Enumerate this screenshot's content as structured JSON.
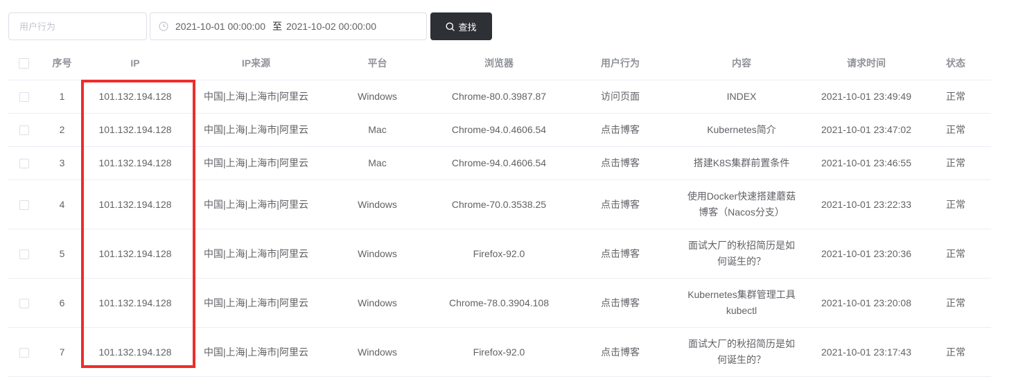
{
  "filters": {
    "behavior_placeholder": "用户行为",
    "date_start": "2021-10-01 00:00:00",
    "date_separator": "至",
    "date_end": "2021-10-02 00:00:00",
    "search_label": "查找"
  },
  "columns": {
    "index": "序号",
    "ip": "IP",
    "ip_source": "IP来源",
    "platform": "平台",
    "browser": "浏览器",
    "behavior": "用户行为",
    "content": "内容",
    "request_time": "请求时间",
    "status": "状态"
  },
  "rows": [
    {
      "index": "1",
      "ip": "101.132.194.128",
      "ip_source": "中国|上海|上海市|阿里云",
      "platform": "Windows",
      "browser": "Chrome-80.0.3987.87",
      "behavior": "访问页面",
      "content": "INDEX",
      "request_time": "2021-10-01 23:49:49",
      "status": "正常"
    },
    {
      "index": "2",
      "ip": "101.132.194.128",
      "ip_source": "中国|上海|上海市|阿里云",
      "platform": "Mac",
      "browser": "Chrome-94.0.4606.54",
      "behavior": "点击博客",
      "content": "Kubernetes简介",
      "request_time": "2021-10-01 23:47:02",
      "status": "正常"
    },
    {
      "index": "3",
      "ip": "101.132.194.128",
      "ip_source": "中国|上海|上海市|阿里云",
      "platform": "Mac",
      "browser": "Chrome-94.0.4606.54",
      "behavior": "点击博客",
      "content": "搭建K8S集群前置条件",
      "request_time": "2021-10-01 23:46:55",
      "status": "正常"
    },
    {
      "index": "4",
      "ip": "101.132.194.128",
      "ip_source": "中国|上海|上海市|阿里云",
      "platform": "Windows",
      "browser": "Chrome-70.0.3538.25",
      "behavior": "点击博客",
      "content": "使用Docker快速搭建蘑菇博客（Nacos分支）",
      "request_time": "2021-10-01 23:22:33",
      "status": "正常"
    },
    {
      "index": "5",
      "ip": "101.132.194.128",
      "ip_source": "中国|上海|上海市|阿里云",
      "platform": "Windows",
      "browser": "Firefox-92.0",
      "behavior": "点击博客",
      "content": "面试大厂的秋招简历是如何诞生的？",
      "request_time": "2021-10-01 23:20:36",
      "status": "正常"
    },
    {
      "index": "6",
      "ip": "101.132.194.128",
      "ip_source": "中国|上海|上海市|阿里云",
      "platform": "Windows",
      "browser": "Chrome-78.0.3904.108",
      "behavior": "点击博客",
      "content": "Kubernetes集群管理工具kubectl",
      "request_time": "2021-10-01 23:20:08",
      "status": "正常"
    },
    {
      "index": "7",
      "ip": "101.132.194.128",
      "ip_source": "中国|上海|上海市|阿里云",
      "platform": "Windows",
      "browser": "Firefox-92.0",
      "behavior": "点击博客",
      "content": "面试大厂的秋招简历是如何诞生的？",
      "request_time": "2021-10-01 23:17:43",
      "status": "正常"
    }
  ],
  "colors": {
    "search_button": "#2d3035",
    "highlight_box": "#ef2c2c",
    "border": "#dcdfe6"
  },
  "icons": {
    "date_prefix": "clock-icon",
    "search_button": "search-icon"
  }
}
